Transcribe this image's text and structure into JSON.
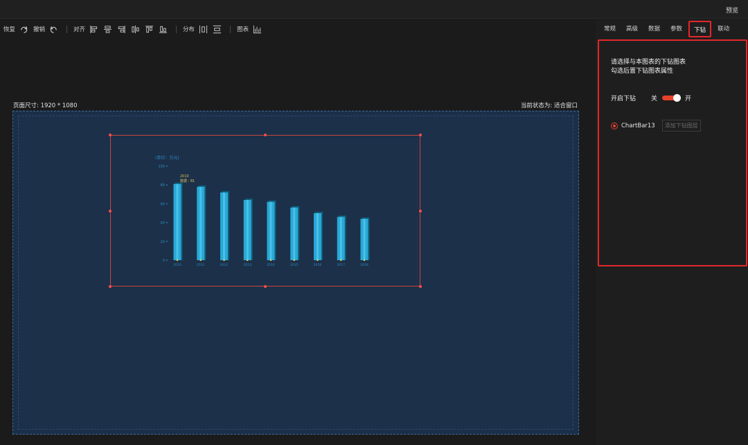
{
  "header": {
    "preview_label": "预览"
  },
  "toolbar": {
    "redo_label": "恢复",
    "undo_label": "撤销",
    "align_label": "对齐",
    "distribute_label": "分布",
    "chart_label": "图表",
    "icons": [
      "redo-icon",
      "undo-icon",
      "align-left-icon",
      "align-center-h-icon",
      "align-right-icon",
      "align-middle-v-icon",
      "align-top-icon",
      "align-bottom-icon",
      "distribute-h-icon",
      "distribute-v-icon",
      "chart-icon"
    ]
  },
  "canvas": {
    "page_size_label": "页面尺寸: 1920 * 1080",
    "state_label": "当前状态为: 适合窗口"
  },
  "chart_data": {
    "type": "bar",
    "unit_label": "(单位：万元)",
    "categories": [
      "2010",
      "2011",
      "2012",
      "2013",
      "2014",
      "2015",
      "2016",
      "2017",
      "2018"
    ],
    "values": [
      81,
      78,
      72,
      64,
      62,
      56,
      50,
      46,
      44
    ],
    "ylim": [
      0,
      100
    ],
    "yticks": [
      0,
      20,
      40,
      60,
      80,
      100
    ],
    "tooltip": {
      "title": "2010",
      "text": "数据 : 81"
    },
    "colors": {
      "bar": "#29a8d6",
      "bar_shadow": "#0e5f79",
      "axis_text": "#2a8cc2",
      "tooltip_text": "#d8c25a"
    }
  },
  "sidepanel": {
    "tabs": [
      "常规",
      "高级",
      "数据",
      "参数",
      "下钻",
      "联动"
    ],
    "active_tab": "下钻",
    "desc_line1": "请选择与本图表的下钻图表",
    "desc_line2": "勾选后置下钻图表属性",
    "toggle_label": "开启下钻",
    "toggle_off": "关",
    "toggle_on": "开",
    "toggle_value": true,
    "chart_option": "ChartBar13",
    "add_layer_label": "添加下钻图层"
  }
}
